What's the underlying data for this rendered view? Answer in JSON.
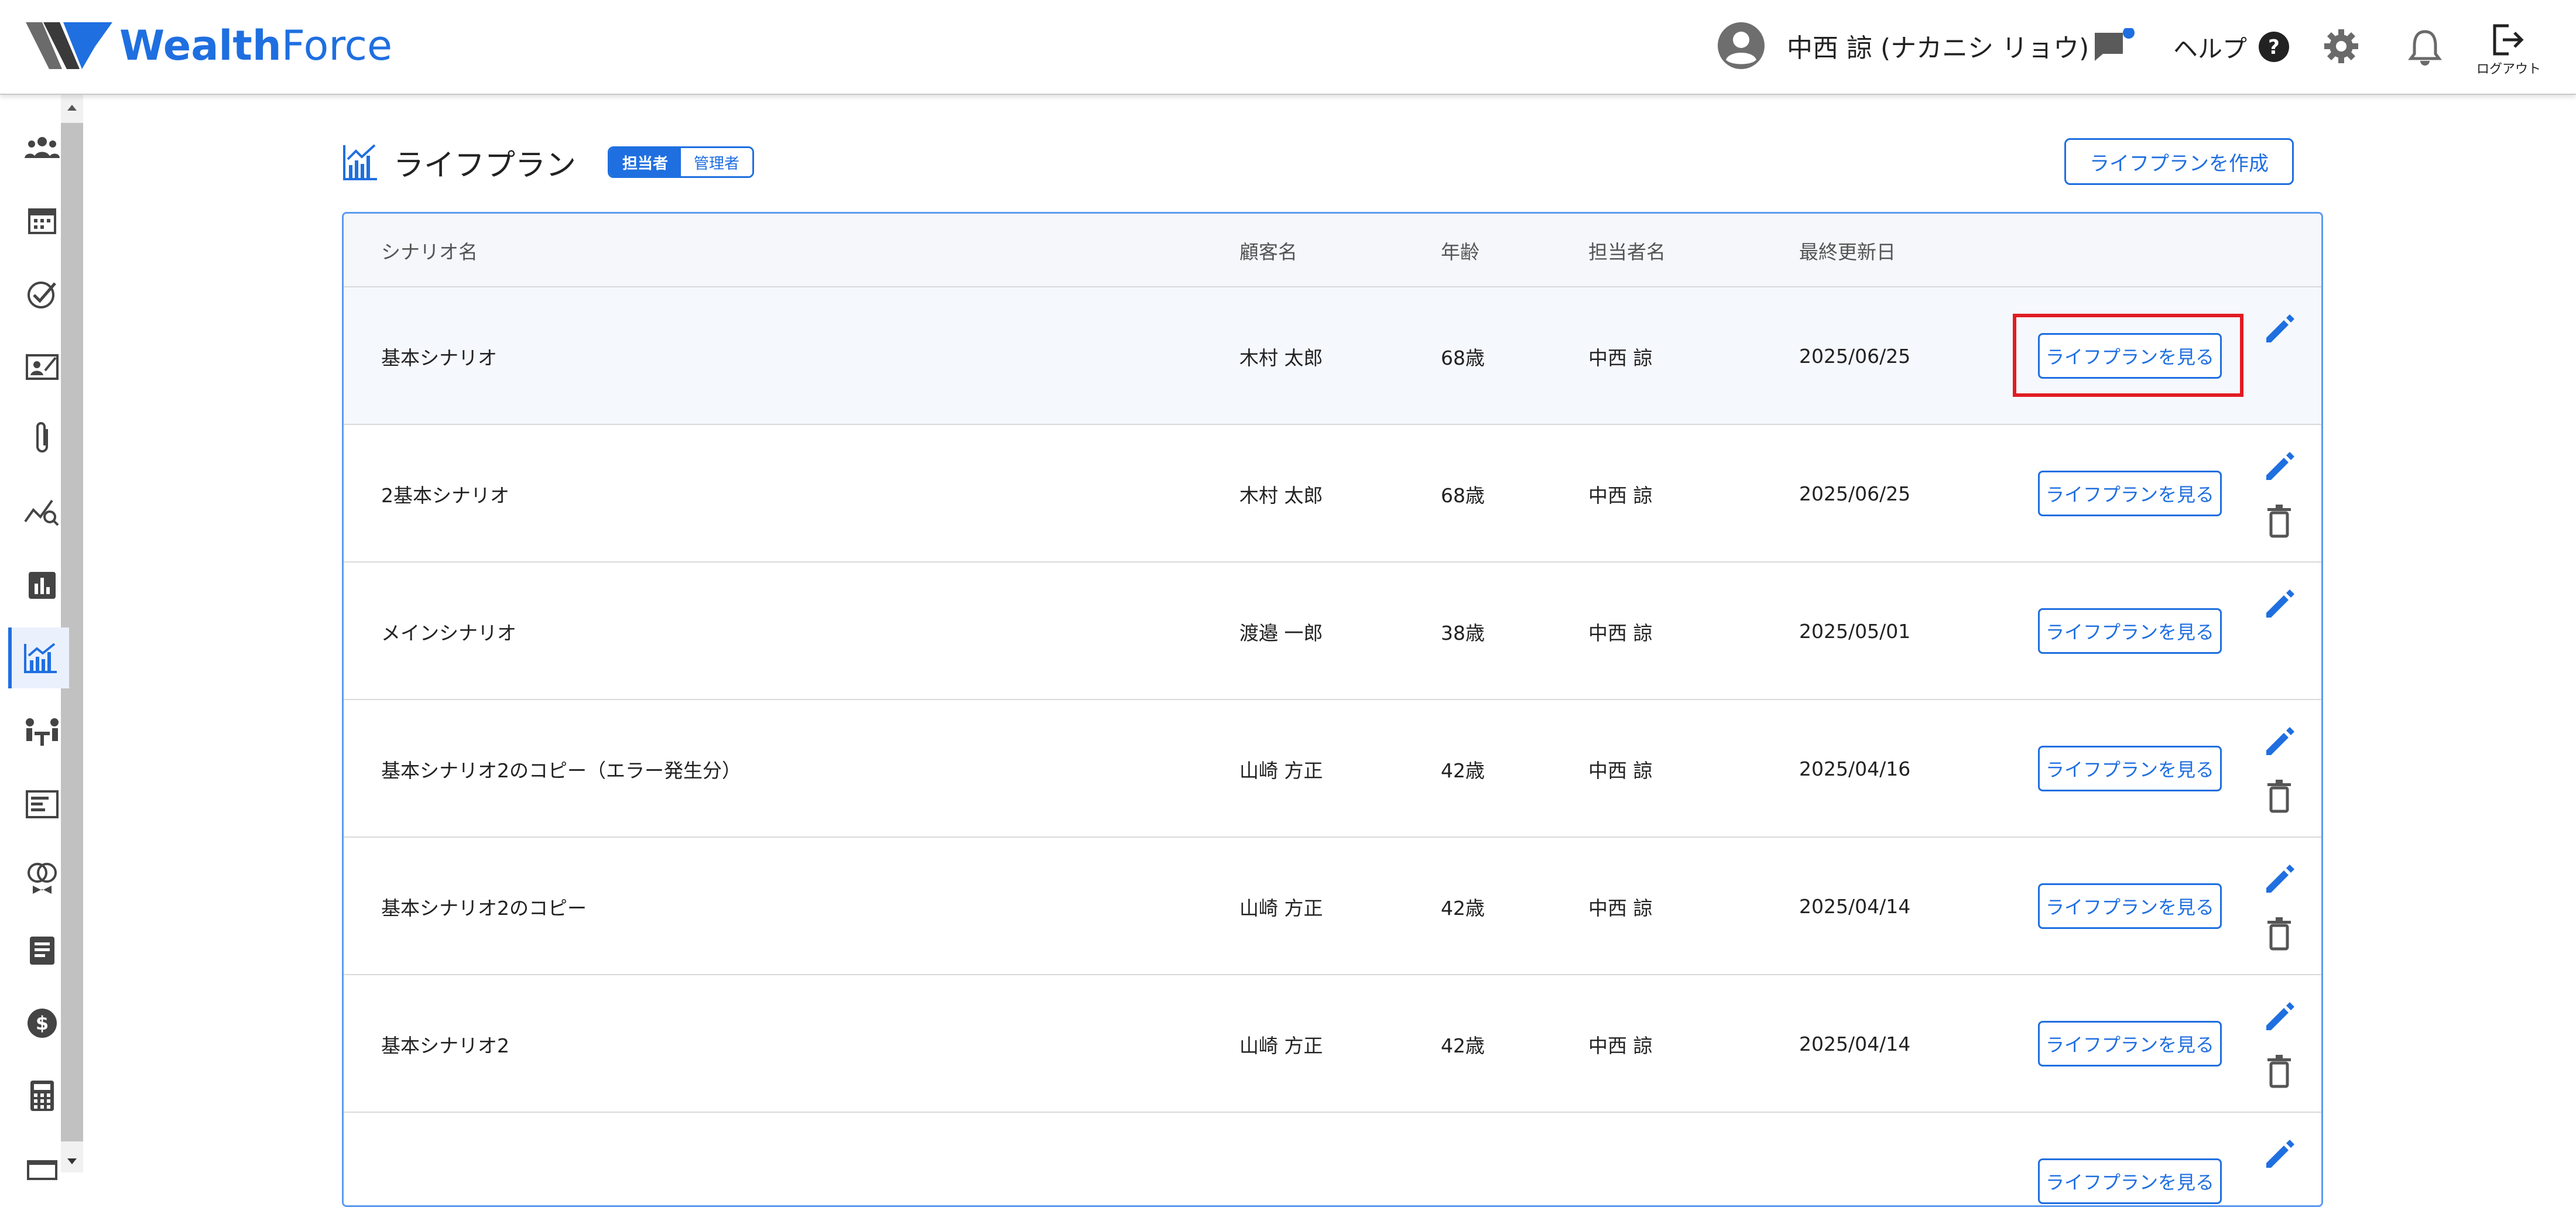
{
  "header": {
    "logo_bold": "Wealth",
    "logo_light": "Force",
    "user_name": "中西 諒 (ナカニシ リョウ)",
    "help_label": "ヘルプ",
    "logout_label": "ログアウト"
  },
  "sidebar": {
    "items": [
      {
        "icon": "people-icon"
      },
      {
        "icon": "calendar-icon"
      },
      {
        "icon": "check-circle-icon"
      },
      {
        "icon": "contact-card-icon"
      },
      {
        "icon": "paperclip-icon"
      },
      {
        "icon": "chart-search-icon"
      },
      {
        "icon": "bar-chart-icon"
      },
      {
        "icon": "lifeplan-chart-icon",
        "active": true
      },
      {
        "icon": "meeting-icon"
      },
      {
        "icon": "article-icon"
      },
      {
        "icon": "rings-icon"
      },
      {
        "icon": "document-icon"
      },
      {
        "icon": "dollar-icon"
      },
      {
        "icon": "calculator-icon"
      },
      {
        "icon": "tray-icon"
      }
    ]
  },
  "page": {
    "title": "ライフプラン",
    "toggle_on": "担当者",
    "toggle_off": "管理者",
    "create_button": "ライフプランを作成"
  },
  "table": {
    "columns": [
      "シナリオ名",
      "顧客名",
      "年齢",
      "担当者名",
      "最終更新日"
    ],
    "view_button": "ライフプランを見る",
    "rows": [
      {
        "scenario": "基本シナリオ",
        "customer": "木村 太郎",
        "age": "68歳",
        "staff": "中西 諒",
        "updated": "2025/06/25",
        "deletable": false
      },
      {
        "scenario": "2基本シナリオ",
        "customer": "木村 太郎",
        "age": "68歳",
        "staff": "中西 諒",
        "updated": "2025/06/25",
        "deletable": true
      },
      {
        "scenario": "メインシナリオ",
        "customer": "渡邉 一郎",
        "age": "38歳",
        "staff": "中西 諒",
        "updated": "2025/05/01",
        "deletable": false
      },
      {
        "scenario": "基本シナリオ2のコピー（エラー発生分）",
        "customer": "山崎 方正",
        "age": "42歳",
        "staff": "中西 諒",
        "updated": "2025/04/16",
        "deletable": true
      },
      {
        "scenario": "基本シナリオ2のコピー",
        "customer": "山崎 方正",
        "age": "42歳",
        "staff": "中西 諒",
        "updated": "2025/04/14",
        "deletable": true
      },
      {
        "scenario": "基本シナリオ2",
        "customer": "山崎 方正",
        "age": "42歳",
        "staff": "中西 諒",
        "updated": "2025/04/14",
        "deletable": true
      },
      {
        "scenario": "",
        "customer": "",
        "age": "",
        "staff": "",
        "updated": "",
        "deletable": false
      }
    ]
  },
  "colors": {
    "accent": "#1f6fe0",
    "highlight": "#e11b22"
  }
}
